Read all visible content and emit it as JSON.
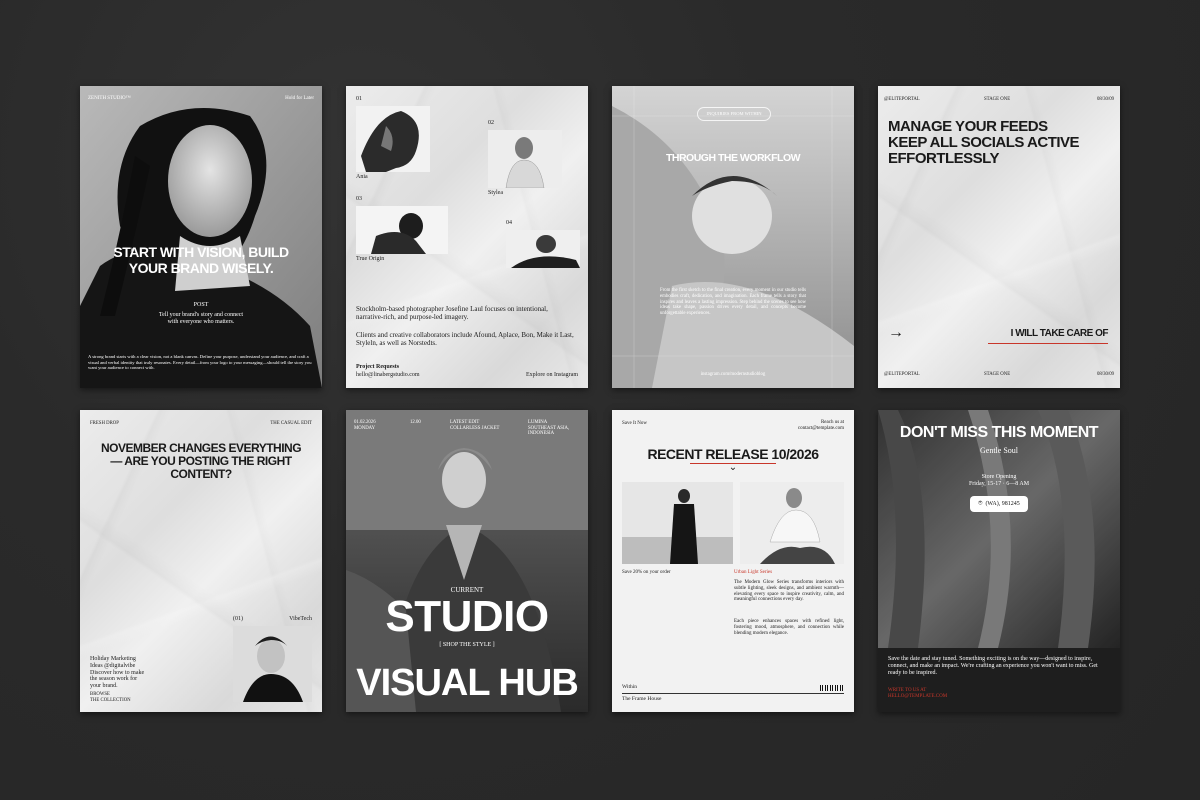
{
  "colors": {
    "background": "#2a2a2a",
    "accent_red": "#c8362a",
    "ink": "#1a1a1a"
  },
  "card1": {
    "brand": "ZENITH STUDIO™",
    "hold": "Hold for Later",
    "headline_l1": "START WITH VISION, BUILD",
    "headline_l2": "YOUR BRAND WISELY.",
    "post": "POST",
    "sub_l1": "Tell your brand's story and connect",
    "sub_l2": "with everyone who matters.",
    "body": "A strong brand starts with a clear vision, not a blank canvas. Define your purpose, understand your audience, and craft a visual and verbal identity that truly resonates. Every detail—from your logo to your messaging—should tell the story you want your audience to connect with."
  },
  "card2": {
    "n1": "01",
    "n2": "02",
    "n3": "03",
    "n4": "04",
    "l1": "Ania",
    "l2": "Stylea",
    "l3": "True Origin",
    "p1": "Stockholm-based photographer Josefine Laul focuses on intentional, narrative-rich, and purpose-led imagery.",
    "p2": "Clients and creative collaborators include Afound, Aplace, Bon, Make it Last, Styleln, as well as Norstedts.",
    "req": "Project Requests",
    "email": "hello@linabergstudio.com",
    "explore": "Explore on Instagram"
  },
  "card3": {
    "pill": "INQUIRIES FROM WITHIN",
    "headline": "THROUGH THE WORKFLOW",
    "body": "From the first sketch to the final creation, every moment in our studio tells embodies craft, dedication, and imagination. Each frame tells a story that inspires and leaves a lasting impression. Step behind the scenes to see how ideas take shape, passion drives every detail, and concepts become unforgettable experiences.",
    "handle": "instagram.com/modernstudioblog"
  },
  "card4": {
    "top_left": "@ELITEPORTAL",
    "top_mid": "STAGE ONE",
    "top_right": "08/30/09",
    "h1": "MANAGE YOUR FEEDS",
    "h2": "KEEP ALL SOCIALS ACTIVE",
    "h3": "EFFORTLESSLY",
    "arrow": "→",
    "care": "I WILL TAKE CARE OF",
    "bot_left": "@ELITEPORTAL",
    "bot_mid": "STAGE ONE",
    "bot_right": "08/30/09"
  },
  "card5": {
    "top_left": "FRESH DROP",
    "top_right": "THE CASUAL EDIT",
    "h1": "NOVEMBER CHANGES EVERYTHING",
    "h2": "— ARE YOU POSTING THE RIGHT",
    "h3": "CONTENT?",
    "num": "(01)",
    "brand": "VibeTech",
    "side_l1": "Holiday Marketing",
    "side_l2": "Ideas @digitalvibe",
    "side_l3": "Discover how to make",
    "side_l4": "the season work for",
    "side_l5": "your brand.",
    "browse_l1": "BROWSE",
    "browse_l2": "THE COLLECTION"
  },
  "card6": {
    "date": "01.02.2026",
    "day": "MONDAY",
    "time": "12.00",
    "col2_l1": "LATEST EDIT",
    "col2_l2": "COLLARLESS JACKET",
    "col3_l1": "LUMINA",
    "col3_l2": "SOUTHEAST ASIA,",
    "col3_l3": "INDONESIA",
    "current": "CURRENT",
    "big1": "STUDIO",
    "shop": "[ SHOP THE STYLE ]",
    "big2": "VISUAL HUB"
  },
  "card7": {
    "save": "Save It Now",
    "reach_l1": "Reach us at",
    "reach_l2": "contact@template.com",
    "headline": "RECENT RELEASE 10/2026",
    "chevron": "⌄",
    "offer": "Save 20% on your order",
    "series": "Urban Light Series",
    "p1": "The Modern Glow Series transforms interiors with subtle lighting, sleek designs, and ambient warmth—elevating every space to inspire creativity, calm, and meaningful connections every day.",
    "p2": "Each piece enhances spaces with refined light, fostering mood, atmosphere, and connection while blending modern elegance.",
    "within": "Within",
    "house": "The Frame House"
  },
  "card8": {
    "headline": "DON'T MISS THIS MOMENT",
    "brand": "Gentle Soul",
    "opening_l1": "Store Opening",
    "opening_l2": "Friday, 15-17 · 6—8 AM",
    "phone": "(WA), 981245",
    "body": "Save the date and stay tuned. Something exciting is on the way—designed to inspire, connect, and make an impact. We're crafting an experience you won't want to miss. Get ready to be inspired.",
    "write_l1": "WRITE TO US AT",
    "write_l2": "HELLO@TEMPLATE.COM"
  }
}
